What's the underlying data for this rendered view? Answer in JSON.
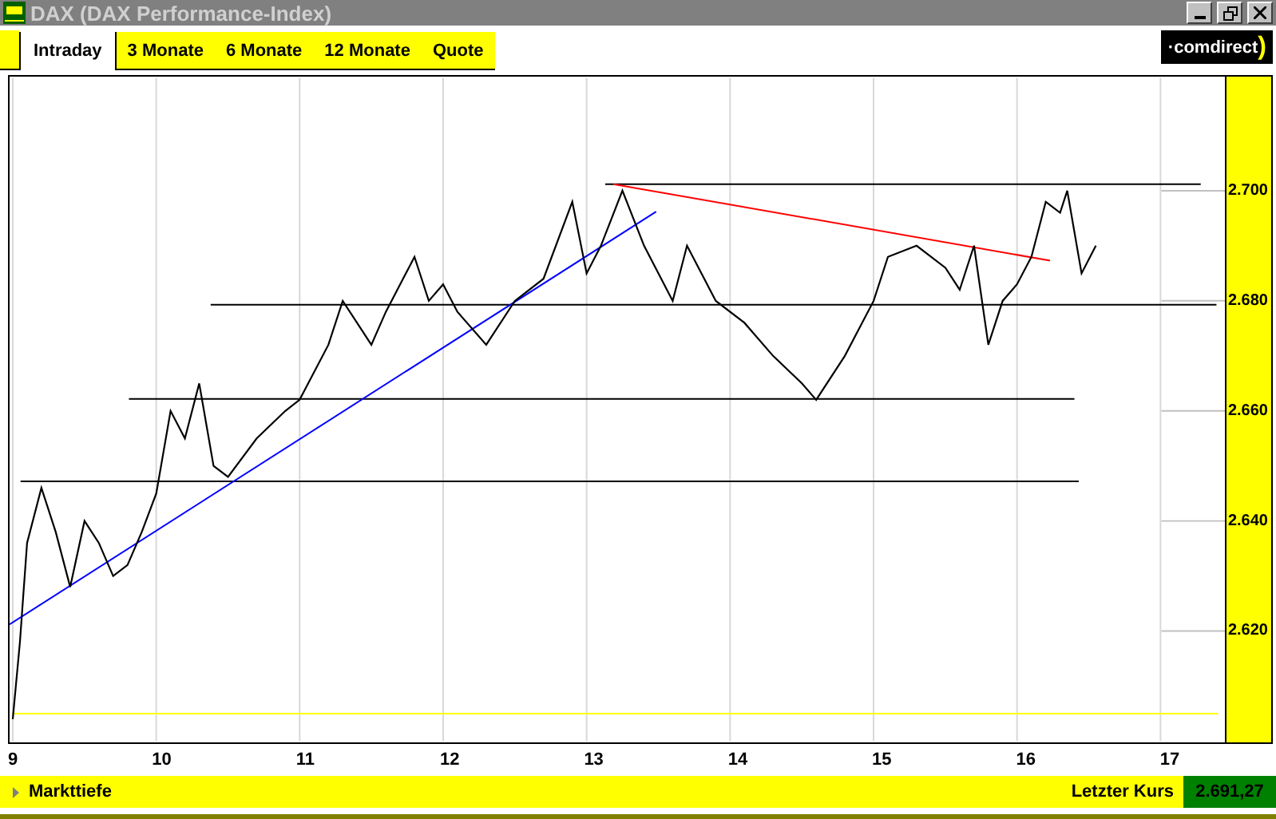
{
  "window": {
    "title": "DAX (DAX Performance-Index)"
  },
  "tabs": [
    {
      "label": "Intraday",
      "selected": true
    },
    {
      "label": "3 Monate",
      "selected": false
    },
    {
      "label": "6 Monate",
      "selected": false
    },
    {
      "label": "12 Monate",
      "selected": false
    },
    {
      "label": "Quote",
      "selected": false
    }
  ],
  "logo": {
    "text": "·comdirect",
    "mark": ")"
  },
  "chart": {
    "chart_data": {
      "type": "line",
      "grid": true,
      "xlim": [
        8.978,
        17.45
      ],
      "ylim": [
        2600,
        2720.5
      ],
      "x": [
        9.0,
        9.05,
        9.1,
        9.2,
        9.3,
        9.4,
        9.5,
        9.6,
        9.7,
        9.8,
        9.9,
        10.0,
        10.1,
        10.2,
        10.3,
        10.4,
        10.5,
        10.7,
        10.9,
        11.0,
        11.2,
        11.3,
        11.5,
        11.6,
        11.8,
        11.9,
        12.0,
        12.1,
        12.3,
        12.5,
        12.7,
        12.9,
        13.0,
        13.1,
        13.25,
        13.4,
        13.6,
        13.7,
        13.9,
        14.1,
        14.3,
        14.5,
        14.6,
        14.8,
        15.0,
        15.1,
        15.3,
        15.5,
        15.6,
        15.7,
        15.8,
        15.9,
        16.0,
        16.1,
        16.2,
        16.3,
        16.35,
        16.45,
        16.55
      ],
      "series": [
        {
          "color": "#000000",
          "values": [
            2604,
            2618,
            2636,
            2646,
            2638,
            2628,
            2640,
            2636,
            2630,
            2632,
            2638,
            2645,
            2660,
            2655,
            2665,
            2650,
            2648,
            2655,
            2660,
            2662,
            2672,
            2680,
            2672,
            2678,
            2688,
            2680,
            2683,
            2678,
            2672,
            2680,
            2684,
            2698,
            2685,
            2690,
            2700,
            2690,
            2680,
            2690,
            2680,
            2676,
            2670,
            2665,
            2662,
            2670,
            2680,
            2688,
            2690,
            2686,
            2682,
            2690,
            2672,
            2680,
            2683,
            2688,
            2698,
            2696,
            2700,
            2685,
            2690
          ]
        },
        {
          "color": "#0000ff",
          "x": [
            8.978,
            13.485
          ],
          "values": [
            2621.2,
            2696.2
          ]
        },
        {
          "color": "#ff0000",
          "x": [
            13.186,
            16.23
          ],
          "values": [
            2701.2,
            2687.3
          ]
        },
        {
          "color": "#000000",
          "x": [
            13.13,
            17.28
          ],
          "values": [
            2701.2,
            2701.2
          ]
        },
        {
          "color": "#000000",
          "x": [
            10.38,
            17.39
          ],
          "values": [
            2679.3,
            2679.3
          ]
        },
        {
          "color": "#000000",
          "x": [
            9.81,
            16.4
          ],
          "values": [
            2662.2,
            2662.2
          ]
        },
        {
          "color": "#000000",
          "x": [
            9.055,
            16.43
          ],
          "values": [
            2647.2,
            2647.2
          ]
        },
        {
          "color": "#ffff00",
          "x": [
            9.0,
            17.4
          ],
          "values": [
            2605,
            2605
          ]
        }
      ],
      "xticks": [
        9,
        10,
        11,
        12,
        13,
        14,
        15,
        16,
        17
      ],
      "yticks": [
        {
          "value": 2620,
          "label": "2.620"
        },
        {
          "value": 2640,
          "label": "2.640"
        },
        {
          "value": 2660,
          "label": "2.660"
        },
        {
          "value": 2680,
          "label": "2.680"
        },
        {
          "value": 2700,
          "label": "2.700"
        }
      ]
    }
  },
  "footer": {
    "link": "Markttiefe",
    "last_label": "Letzter Kurs",
    "last_value": "2.691,27"
  }
}
